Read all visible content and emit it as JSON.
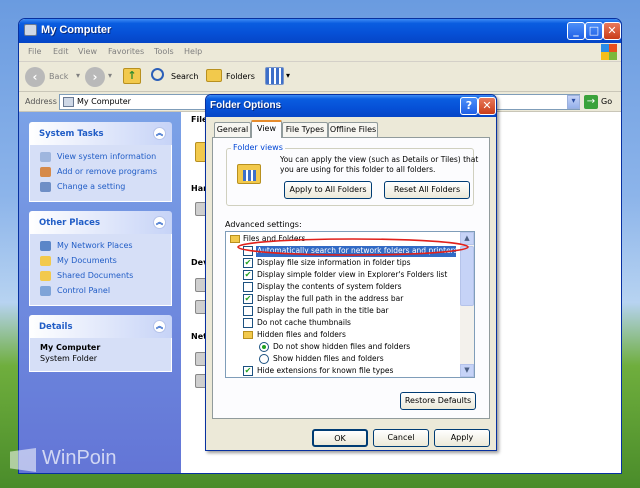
{
  "window": {
    "title": "My Computer"
  },
  "menu": [
    "File",
    "Edit",
    "View",
    "Favorites",
    "Tools",
    "Help"
  ],
  "toolbar": {
    "back": "Back",
    "search": "Search",
    "folders": "Folders"
  },
  "address": {
    "label": "Address",
    "value": "My Computer",
    "go": "Go"
  },
  "tasks": {
    "system": {
      "title": "System Tasks",
      "items": [
        "View system information",
        "Add or remove programs",
        "Change a setting"
      ]
    },
    "places": {
      "title": "Other Places",
      "items": [
        "My Network Places",
        "My Documents",
        "Shared Documents",
        "Control Panel"
      ]
    },
    "details": {
      "title": "Details",
      "name": "My Computer",
      "sub": "System Folder"
    }
  },
  "content": {
    "labels": [
      "File",
      "Har",
      "Dev",
      "Net"
    ]
  },
  "dialog": {
    "title": "Folder Options",
    "tabs": [
      "General",
      "View",
      "File Types",
      "Offline Files"
    ],
    "folder_views": {
      "legend": "Folder views",
      "desc_1": "You can apply the view (such as Details or Tiles) that",
      "desc_2": "you are using for this folder to all folders.",
      "apply_all": "Apply to All Folders",
      "reset_all": "Reset All Folders"
    },
    "advanced_label": "Advanced settings:",
    "settings": [
      {
        "text": "Files and Folders",
        "kind": "folder"
      },
      {
        "text": "Automatically search for network folders and printers",
        "kind": "check",
        "checked": false,
        "selected": true
      },
      {
        "text": "Display file size information in folder tips",
        "kind": "check",
        "checked": true
      },
      {
        "text": "Display simple folder view in Explorer's Folders list",
        "kind": "check",
        "checked": true
      },
      {
        "text": "Display the contents of system folders",
        "kind": "check",
        "checked": false
      },
      {
        "text": "Display the full path in the address bar",
        "kind": "check",
        "checked": true
      },
      {
        "text": "Display the full path in the title bar",
        "kind": "check",
        "checked": false
      },
      {
        "text": "Do not cache thumbnails",
        "kind": "check",
        "checked": false
      },
      {
        "text": "Hidden files and folders",
        "kind": "folder"
      },
      {
        "text": "Do not show hidden files and folders",
        "kind": "radio",
        "checked": true
      },
      {
        "text": "Show hidden files and folders",
        "kind": "radio",
        "checked": false
      },
      {
        "text": "Hide extensions for known file types",
        "kind": "check",
        "checked": true
      }
    ],
    "restore_defaults": "Restore Defaults",
    "ok": "OK",
    "cancel": "Cancel",
    "apply": "Apply"
  },
  "watermark": "WinPoin",
  "colors": {
    "xp_blue": "#0a5de0",
    "highlight": "#316ac5",
    "annotation_red": "#e0201a"
  }
}
